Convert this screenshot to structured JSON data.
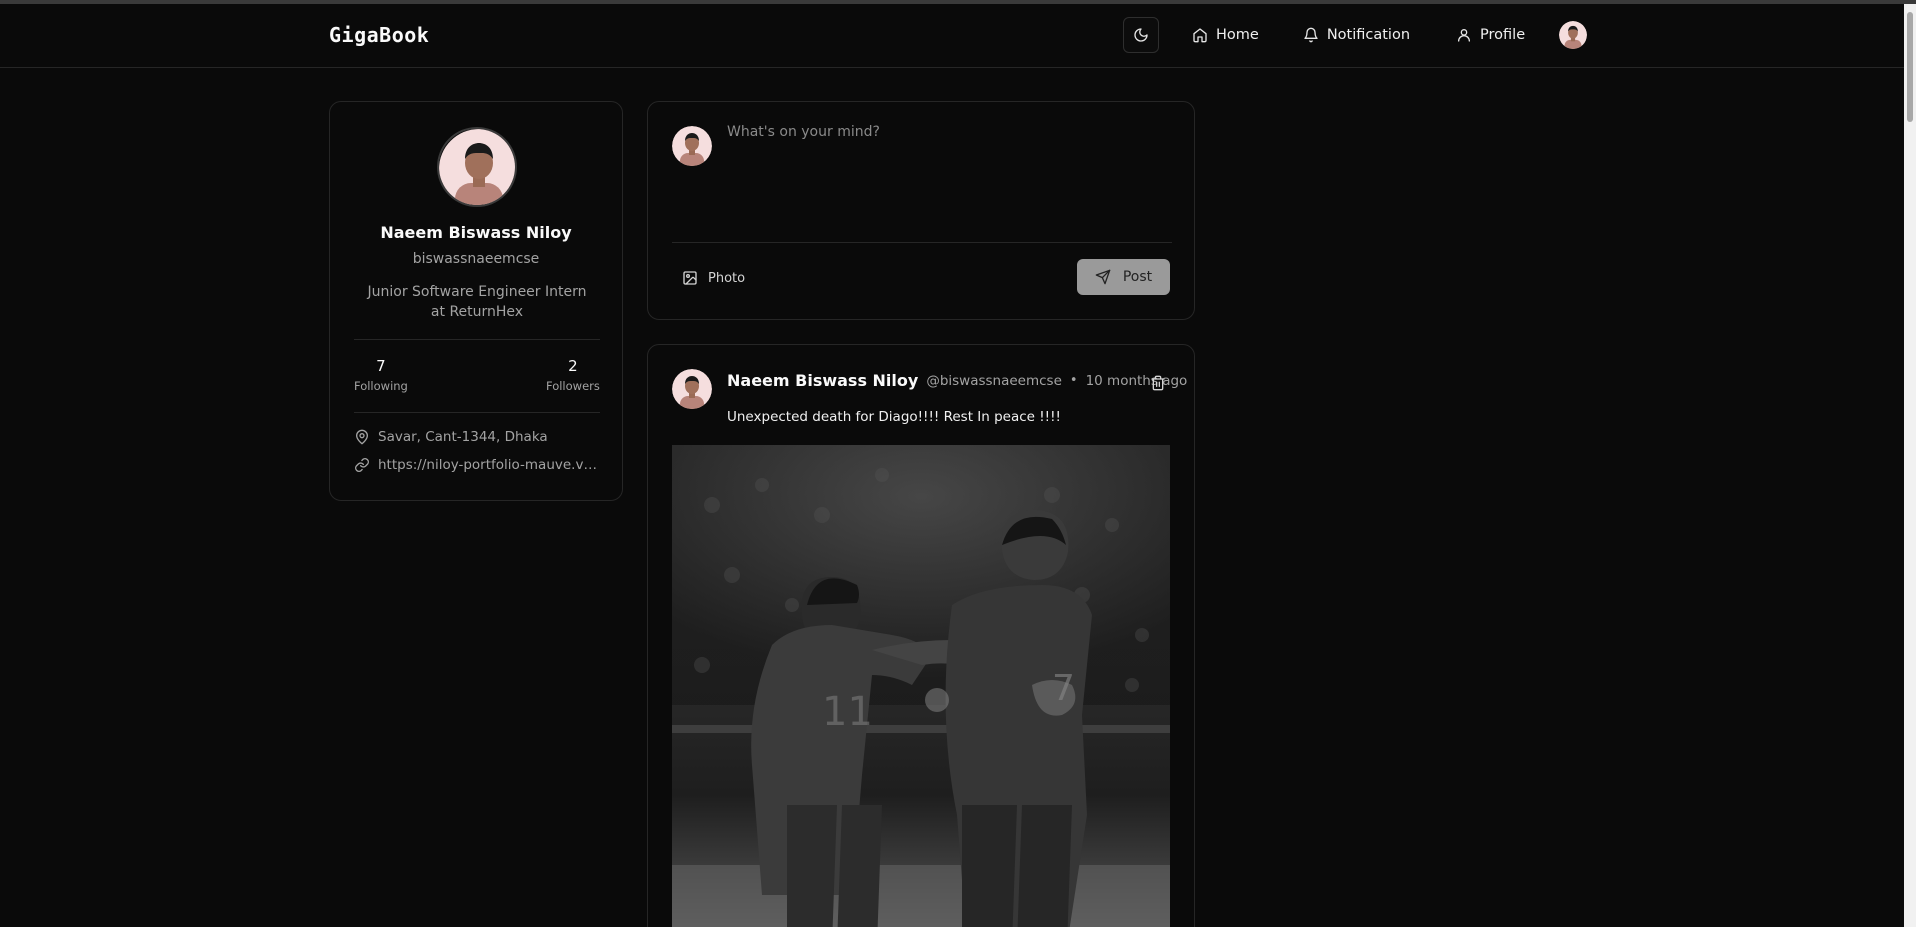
{
  "app": {
    "title": "GigaBook"
  },
  "nav": {
    "theme_toggle_icon": "moon-icon",
    "home": "Home",
    "notification": "Notification",
    "profile": "Profile"
  },
  "profile": {
    "name": "Naeem Biswass Niloy",
    "username": "biswassnaeemcse",
    "bio": "Junior Software Engineer Intern at ReturnHex",
    "following_count": "7",
    "following_label": "Following",
    "followers_count": "2",
    "followers_label": "Followers",
    "location": "Savar, Cant-1344, Dhaka",
    "website": "https://niloy-portfolio-mauve.vercel.app"
  },
  "composer": {
    "placeholder": "What's on your mind?",
    "photo_label": "Photo",
    "post_label": "Post"
  },
  "feed": {
    "posts": [
      {
        "author": "Naeem Biswass Niloy",
        "handle": "@biswassnaeemcse",
        "separator": "•",
        "time": "10 months ago",
        "text": "Unexpected death for Diago!!!! Rest In peace !!!!"
      }
    ]
  },
  "colors": {
    "background": "#0a0a0a",
    "card_border": "#262626",
    "muted_text": "#a3a3a3",
    "post_button": "#9a9a9a"
  }
}
